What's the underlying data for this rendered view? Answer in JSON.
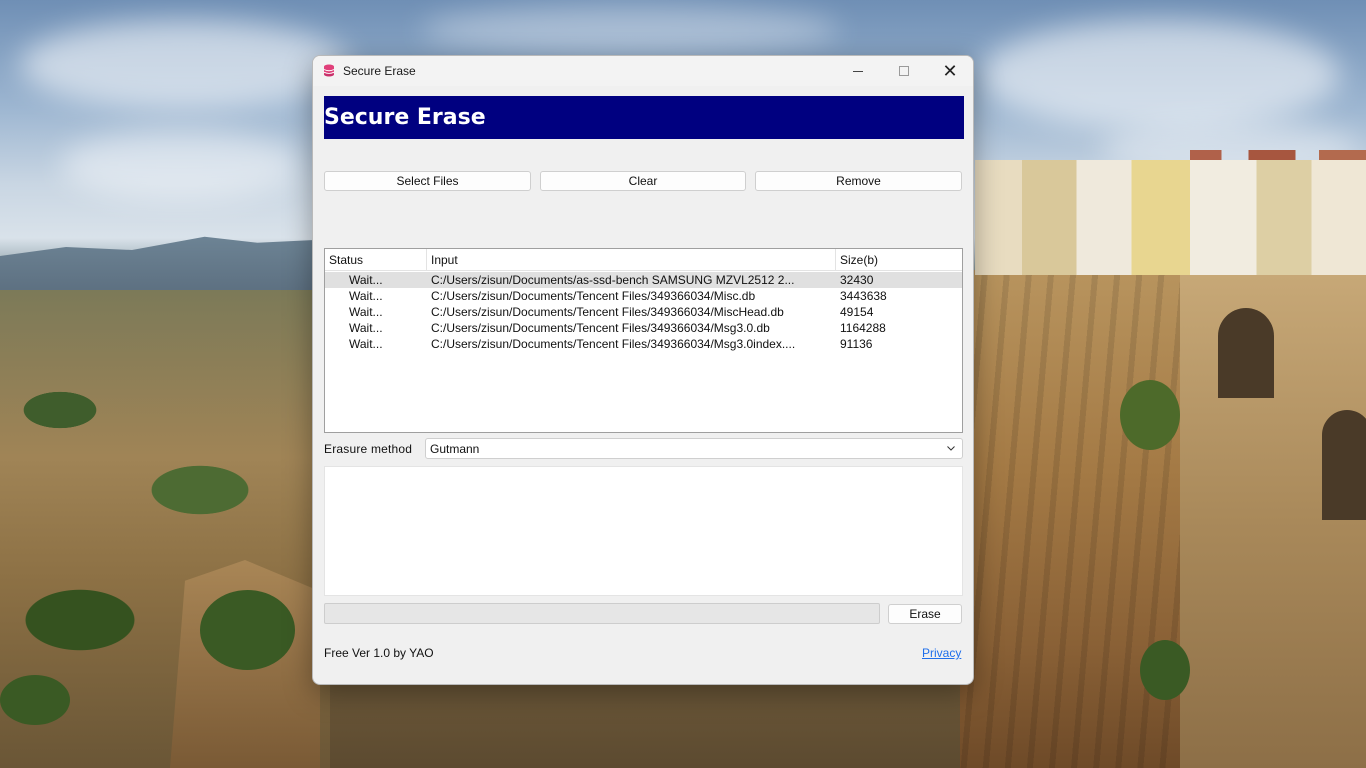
{
  "window": {
    "title": "Secure Erase",
    "icon": "database-icon",
    "controls": {
      "minimize": "minimize-icon",
      "maximize": "maximize-icon",
      "close": "✕"
    }
  },
  "banner": {
    "text": "Secure Erase"
  },
  "toolbar": {
    "select_files_label": "Select Files",
    "clear_label": "Clear",
    "remove_label": "Remove"
  },
  "file_table": {
    "columns": [
      "Status",
      "Input",
      "Size(b)"
    ],
    "rows": [
      {
        "status": "Wait...",
        "input": "C:/Users/zisun/Documents/as-ssd-bench SAMSUNG MZVL2512 2...",
        "size": "32430",
        "selected": true
      },
      {
        "status": "Wait...",
        "input": "C:/Users/zisun/Documents/Tencent Files/349366034/Misc.db",
        "size": "3443638",
        "selected": false
      },
      {
        "status": "Wait...",
        "input": "C:/Users/zisun/Documents/Tencent Files/349366034/MiscHead.db",
        "size": "49154",
        "selected": false
      },
      {
        "status": "Wait...",
        "input": "C:/Users/zisun/Documents/Tencent Files/349366034/Msg3.0.db",
        "size": "1164288",
        "selected": false
      },
      {
        "status": "Wait...",
        "input": "C:/Users/zisun/Documents/Tencent Files/349366034/Msg3.0index....",
        "size": "91136",
        "selected": false
      }
    ]
  },
  "erasure": {
    "label": "Erasure method",
    "selected": "Gutmann"
  },
  "progress": {
    "value_percent": 0
  },
  "actions": {
    "erase_label": "Erase"
  },
  "footer": {
    "version": "Free Ver 1.0 by YAO",
    "privacy_link": "Privacy"
  },
  "colors": {
    "banner_bg": "#000080",
    "banner_text": "#ffffff",
    "link": "#1f6feb",
    "selected_row": "#e0e0e0"
  }
}
